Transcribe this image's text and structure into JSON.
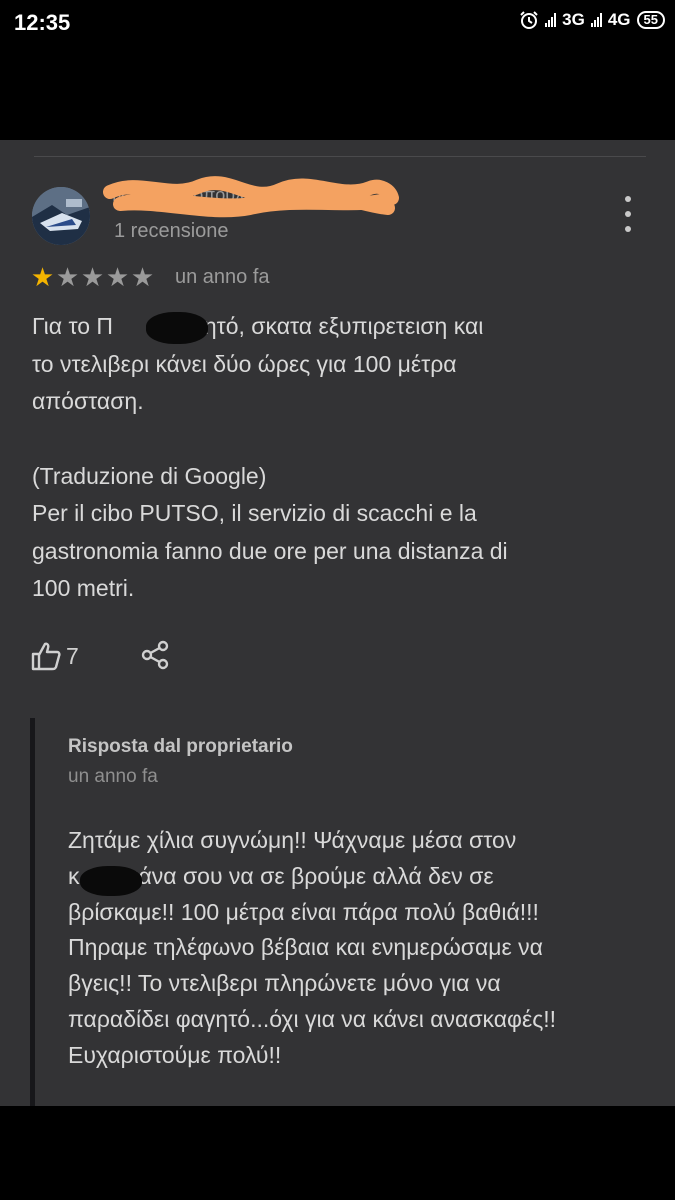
{
  "status_bar": {
    "time": "12:35",
    "network_1": "3G",
    "network_2": "4G",
    "battery": "55",
    "icons": [
      "alarm-icon",
      "signal-icon",
      "signal-icon",
      "battery-icon"
    ]
  },
  "review": {
    "reviewer_name": "Ν. ...ερδ...οπουλο",
    "review_count": "1 recensione",
    "rating": 1,
    "rating_max": 5,
    "time_ago": "un anno fa",
    "original_lines": [
      "Για το Π        φαγητό, σκατα εξυπιρετειση και",
      "το ντελιβερι κάνει δύο ώρες για 100 μέτρα",
      "απόσταση."
    ],
    "translation_label": "(Traduzione di Google)",
    "translation_lines": [
      "Per il cibo PUTSO, il servizio di scacchi e la",
      "gastronomia fanno due ore per una distanza di",
      "100 metri."
    ],
    "likes": "7",
    "colors": {
      "star_filled": "#f4b400",
      "star_empty": "#9a9a9a",
      "redaction": "#f4a261"
    }
  },
  "owner_reply": {
    "title": "Risposta dal proprietario",
    "time_ago": "un anno fa",
    "lines": [
      "Ζητάμε χίλια συγνώμη!! Ψάχναμε μέσα στον",
      "κ        τής μάνα σου να σε βρούμε αλλά δεν σε",
      "βρίσκαμε!! 100 μέτρα είναι πάρα πολύ βαθιά!!!",
      "Πηραμε τηλέφωνο βέβαια και ενημερώσαμε να",
      "βγεις!! Το ντελιβερι πληρώνετε μόνο για να",
      "παραδίδει φαγητό...όχι για να κάνει ανασκαφές!!",
      "Ευχαριστούμε πολύ!!"
    ]
  }
}
